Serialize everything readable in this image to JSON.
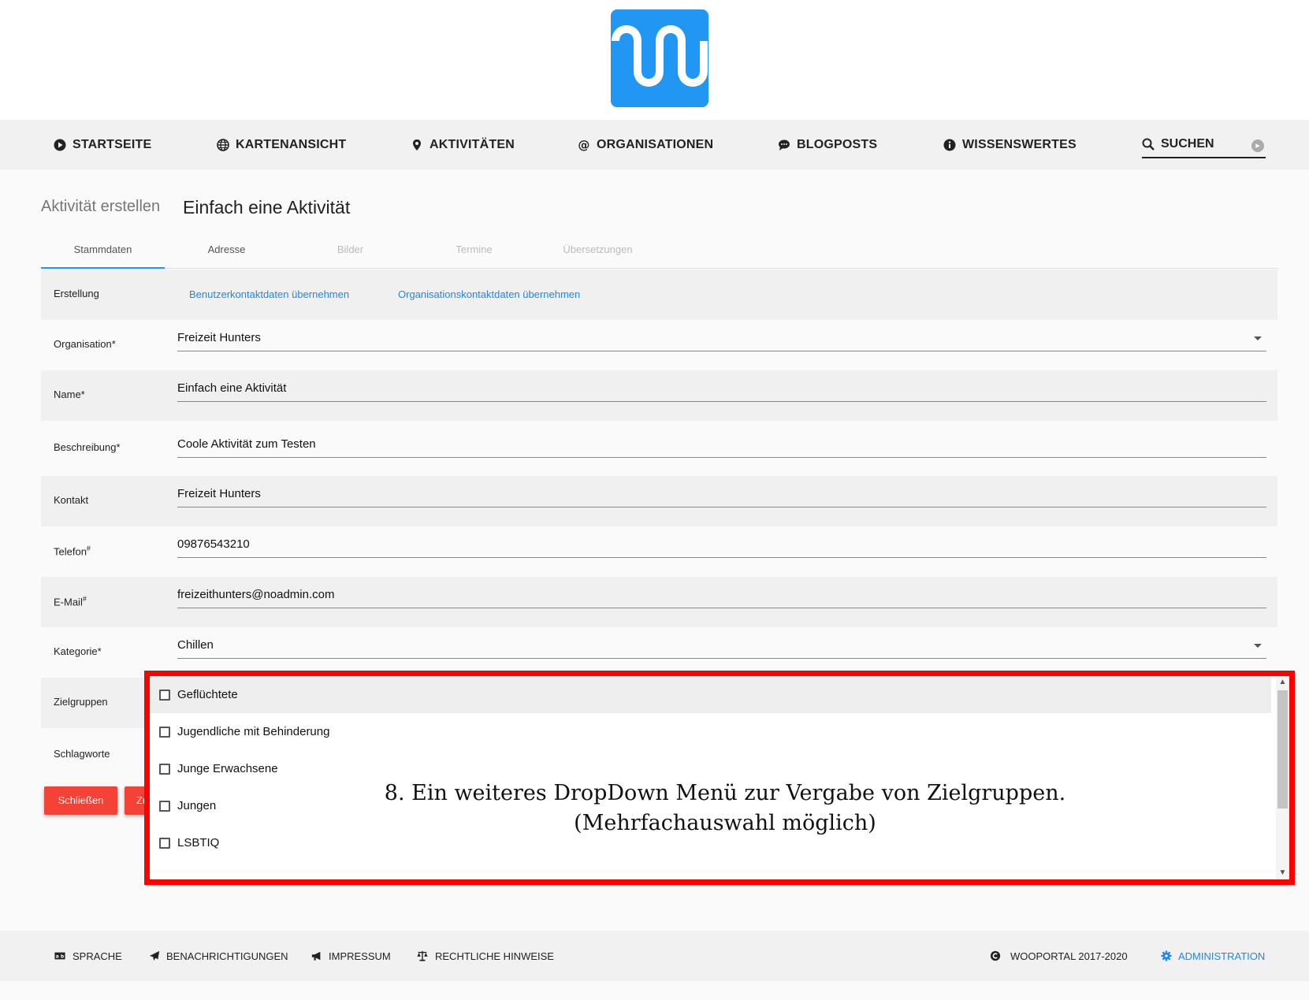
{
  "nav": {
    "items": [
      {
        "label": "STARTSEITE",
        "icon": "play-circle-icon"
      },
      {
        "label": "KARTENANSICHT",
        "icon": "globe-icon"
      },
      {
        "label": "AKTIVITÄTEN",
        "icon": "map-marker-icon"
      },
      {
        "label": "ORGANISATIONEN",
        "icon": "at-icon"
      },
      {
        "label": "BLOGPOSTS",
        "icon": "comment-icon"
      },
      {
        "label": "WISSENSWERTES",
        "icon": "info-circle-icon"
      }
    ],
    "search_label": "SUCHEN"
  },
  "page": {
    "breadcrumb": "Aktivität erstellen",
    "title": "Einfach eine Aktivität"
  },
  "tabs": [
    {
      "label": "Stammdaten",
      "state": "active"
    },
    {
      "label": "Adresse",
      "state": "enabled"
    },
    {
      "label": "Bilder",
      "state": "disabled"
    },
    {
      "label": "Termine",
      "state": "disabled"
    },
    {
      "label": "Übersetzungen",
      "state": "disabled"
    }
  ],
  "form": {
    "erstellung": {
      "label": "Erstellung",
      "link_user": "Benutzerkontaktdaten übernehmen",
      "link_org": "Organisationskontaktdaten übernehmen"
    },
    "organisation": {
      "label": "Organisation*",
      "value": "Freizeit Hunters"
    },
    "name": {
      "label": "Name*",
      "value": "Einfach eine Aktivität"
    },
    "beschreibung": {
      "label": "Beschreibung*",
      "value": "Coole Aktivität zum Testen"
    },
    "kontakt": {
      "label": "Kontakt",
      "value": "Freizeit Hunters"
    },
    "telefon": {
      "label": "Telefon",
      "mark": "#",
      "value": "09876543210"
    },
    "email": {
      "label": "E-Mail",
      "mark": "#",
      "value": "freizeithunters@noadmin.com"
    },
    "kategorie": {
      "label": "Kategorie*",
      "value": "Chillen"
    },
    "zielgruppen": {
      "label": "Zielgruppen"
    },
    "schlagworte": {
      "label": "Schlagworte"
    }
  },
  "buttons": {
    "close": "Schließen",
    "second_partial": "Zu"
  },
  "dropdown": {
    "options": [
      {
        "label": "Geflüchtete",
        "checked": false
      },
      {
        "label": "Jugendliche mit Behinderung",
        "checked": false
      },
      {
        "label": "Junge Erwachsene",
        "checked": false
      },
      {
        "label": "Jungen",
        "checked": false
      },
      {
        "label": "LSBTIQ",
        "checked": false
      }
    ],
    "highlight_color": "#ff0000"
  },
  "annotation": {
    "line1": "8. Ein weiteres DropDown Menü zur Vergabe von Zielgruppen.",
    "line2": "(Mehrfachauswahl möglich)"
  },
  "footer": {
    "language": "SPRACHE",
    "notifications": "BENACHRICHTIGUNGEN",
    "imprint": "IMPRESSUM",
    "legal": "RECHTLICHE HINWEISE",
    "copyright": "WOOPORTAL 2017-2020",
    "admin": "ADMINISTRATION"
  },
  "colors": {
    "accent": "#2196f3",
    "link": "#1e88e5",
    "button": "#f44336"
  }
}
